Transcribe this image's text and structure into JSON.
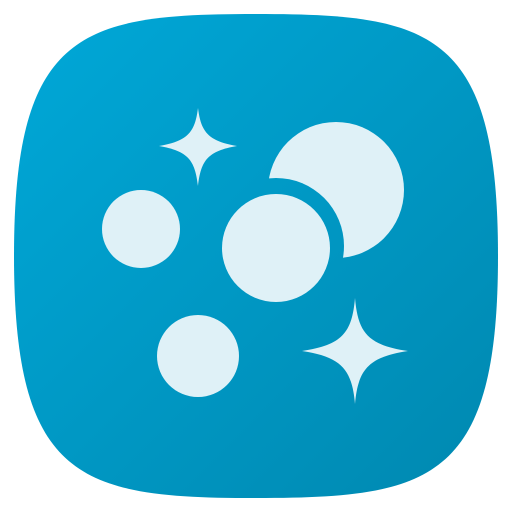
{
  "app_icon": {
    "icon_name": "bubbles-sparkle-app-icon",
    "colors": {
      "background_top": "#00a8d8",
      "background_bottom": "#0088b0",
      "glyph": "#dff1f7"
    },
    "glyphs": [
      "sparkle-icon",
      "bubble-icon",
      "bubble-icon",
      "bubble-icon",
      "bubble-icon",
      "sparkle-icon"
    ]
  }
}
